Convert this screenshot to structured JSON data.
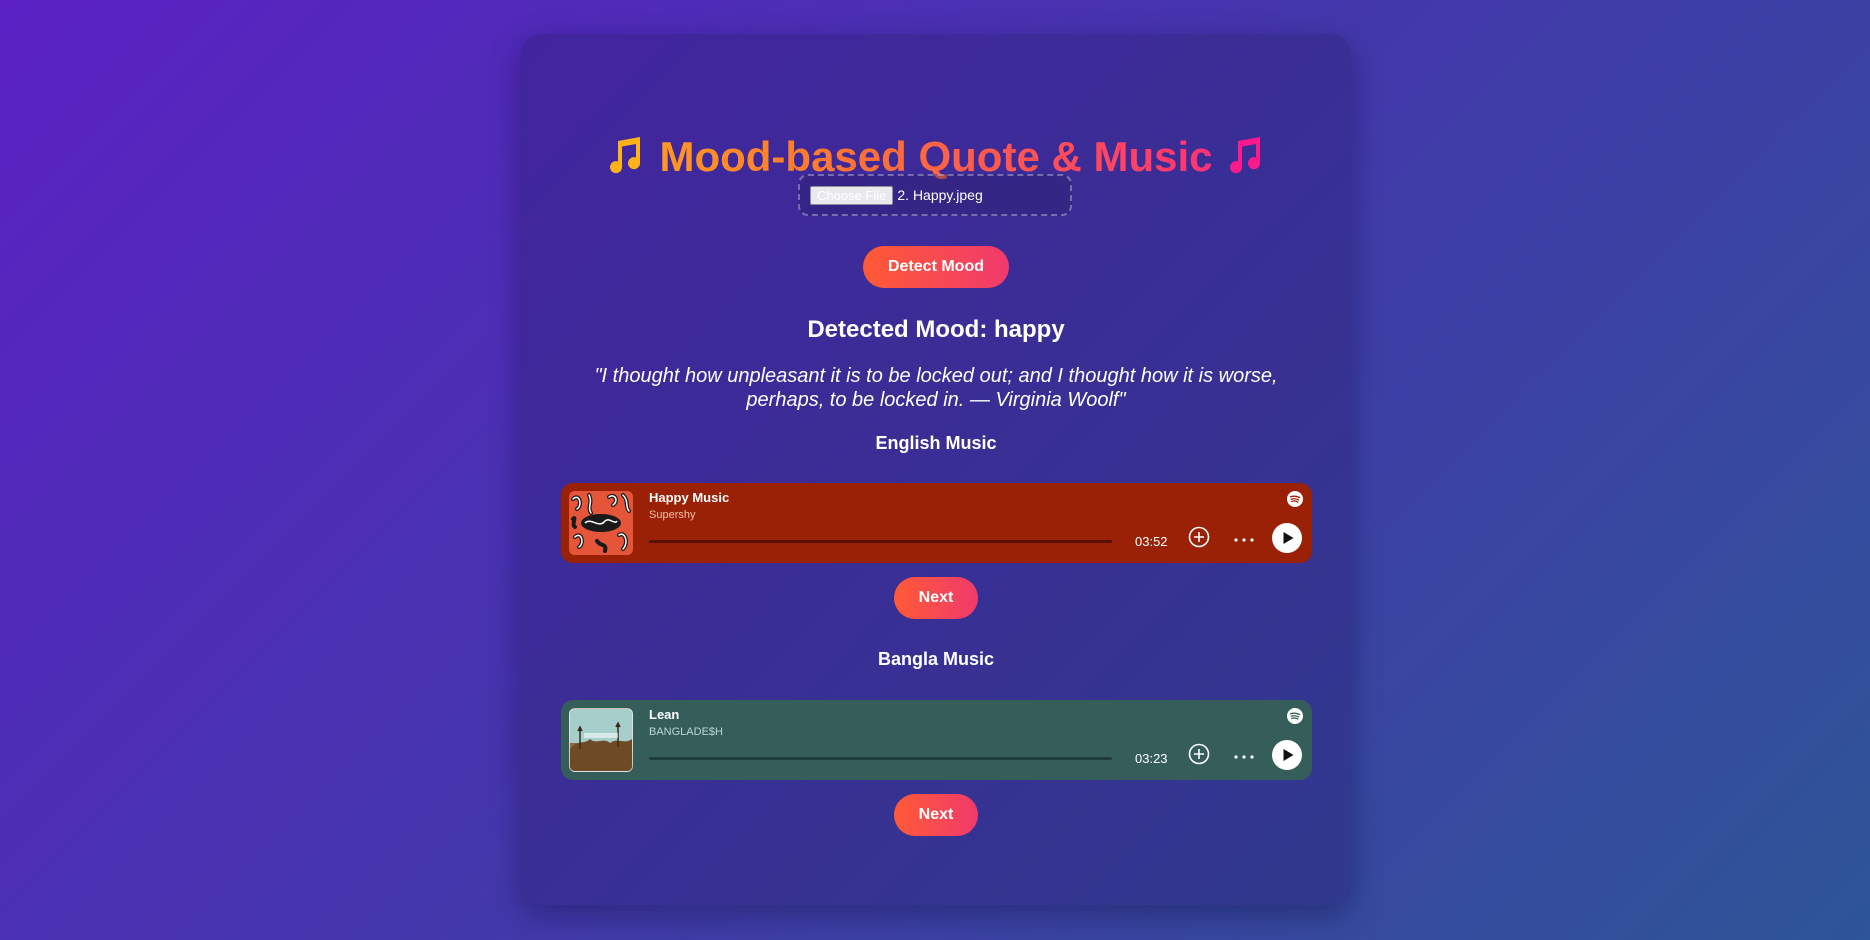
{
  "app": {
    "title": "Mood-based Quote & Music",
    "title_icon_left": "music-note-icon",
    "title_icon_right": "music-note-icon"
  },
  "upload": {
    "button_label": "Choose File",
    "file_name": "2. Happy.jpeg"
  },
  "detect_button": "Detect Mood",
  "mood": {
    "text": "Detected Mood: happy",
    "value": "happy"
  },
  "quote": "\"I thought how unpleasant it is to be locked out; and I thought how it is worse, perhaps, to be locked in. — Virginia Woolf\"",
  "english": {
    "heading": "English Music",
    "player": {
      "track": "Happy Music",
      "artist": "Supershy",
      "duration": "03:52",
      "progress": 0,
      "background": "#9a2006"
    },
    "next_label": "Next"
  },
  "bangla": {
    "heading": "Bangla Music",
    "player": {
      "track": "Lean",
      "artist": "BANGLADE$H",
      "duration": "03:23",
      "progress": 0,
      "background": "#355e5b"
    },
    "next_label": "Next"
  },
  "colors": {
    "accent_start": "#ff5a36",
    "accent_end": "#f03a6c",
    "title_gradient": [
      "#ffb21a",
      "#ff7a2e",
      "#ff4d5a",
      "#ff1a8c"
    ]
  }
}
